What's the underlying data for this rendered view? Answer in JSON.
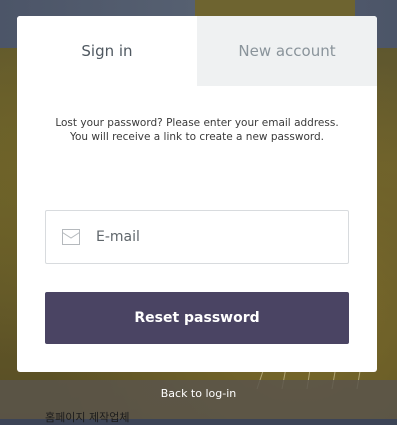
{
  "tabs": [
    {
      "label": "Sign in",
      "active": true
    },
    {
      "label": "New account",
      "active": false
    }
  ],
  "instructions": {
    "line1": "Lost your password? Please enter your email address.",
    "line2": "You will receive a link to create a new password."
  },
  "email_field": {
    "placeholder": "E-mail",
    "value": "",
    "icon": "envelope-icon"
  },
  "reset_button": {
    "label": "Reset password"
  },
  "back_link": {
    "label": "Back to log-in"
  },
  "partial_footer_text": "홈페이지 제작업체",
  "colors": {
    "button_bg": "#4a4463",
    "inactive_tab_bg": "#eff1f2",
    "modal_bg": "#ffffff"
  }
}
